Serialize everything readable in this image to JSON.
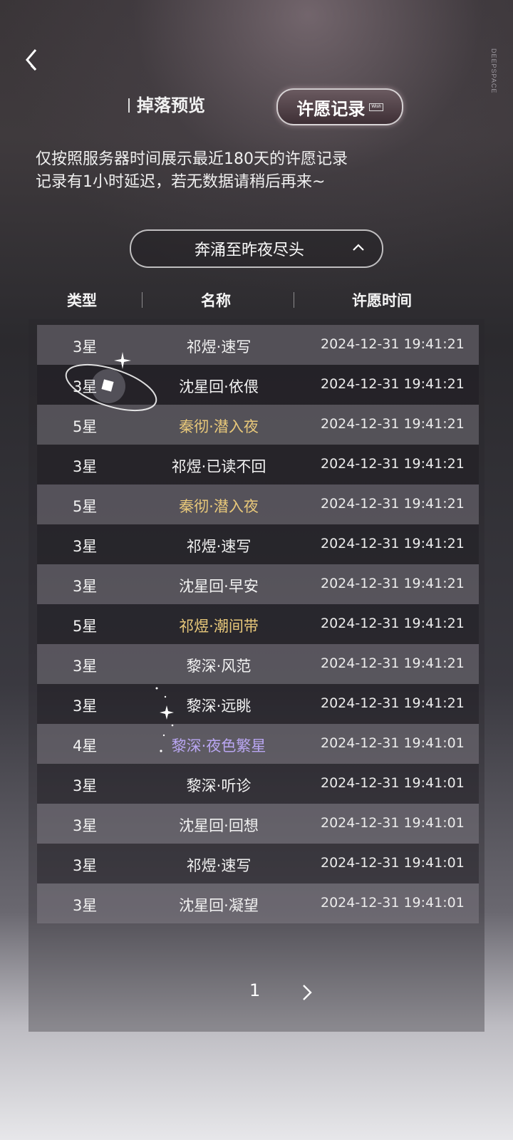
{
  "side_text": "DEEPSPACE",
  "tabs": {
    "drop_preview": "掉落预览",
    "wish_record": "许愿记录",
    "wish_record_sub": "Wish"
  },
  "notice": {
    "line1": "仅按照服务器时间展示最近180天的许愿记录",
    "line2": "记录有1小时延迟，若无数据请稍后再来~"
  },
  "filter": {
    "selected": "奔涌至昨夜尽头"
  },
  "table": {
    "headers": [
      "类型",
      "名称",
      "许愿时间"
    ],
    "rows": [
      {
        "type": "3星",
        "name": "祁煜·速写",
        "time": "2024-12-31 19:41:21",
        "rarity": 3
      },
      {
        "type": "3星",
        "name": "沈星回·依偎",
        "time": "2024-12-31 19:41:21",
        "rarity": 3
      },
      {
        "type": "5星",
        "name": "秦彻·潜入夜",
        "time": "2024-12-31 19:41:21",
        "rarity": 5
      },
      {
        "type": "3星",
        "name": "祁煜·已读不回",
        "time": "2024-12-31 19:41:21",
        "rarity": 3
      },
      {
        "type": "5星",
        "name": "秦彻·潜入夜",
        "time": "2024-12-31 19:41:21",
        "rarity": 5
      },
      {
        "type": "3星",
        "name": "祁煜·速写",
        "time": "2024-12-31 19:41:21",
        "rarity": 3
      },
      {
        "type": "3星",
        "name": "沈星回·早安",
        "time": "2024-12-31 19:41:21",
        "rarity": 3
      },
      {
        "type": "5星",
        "name": "祁煜·潮间带",
        "time": "2024-12-31 19:41:21",
        "rarity": 5
      },
      {
        "type": "3星",
        "name": "黎深·风范",
        "time": "2024-12-31 19:41:21",
        "rarity": 3
      },
      {
        "type": "3星",
        "name": "黎深·远眺",
        "time": "2024-12-31 19:41:21",
        "rarity": 3
      },
      {
        "type": "4星",
        "name": "黎深·夜色繁星",
        "time": "2024-12-31 19:41:01",
        "rarity": 4
      },
      {
        "type": "3星",
        "name": "黎深·听诊",
        "time": "2024-12-31 19:41:01",
        "rarity": 3
      },
      {
        "type": "3星",
        "name": "沈星回·回想",
        "time": "2024-12-31 19:41:01",
        "rarity": 3
      },
      {
        "type": "3星",
        "name": "祁煜·速写",
        "time": "2024-12-31 19:41:01",
        "rarity": 3
      },
      {
        "type": "3星",
        "name": "沈星回·凝望",
        "time": "2024-12-31 19:41:01",
        "rarity": 3
      }
    ]
  },
  "pagination": {
    "current": "1"
  },
  "colors": {
    "rarity5": "#e8c87a",
    "rarity4": "#b9a6f2",
    "rarity3": "#f2f2f2"
  }
}
